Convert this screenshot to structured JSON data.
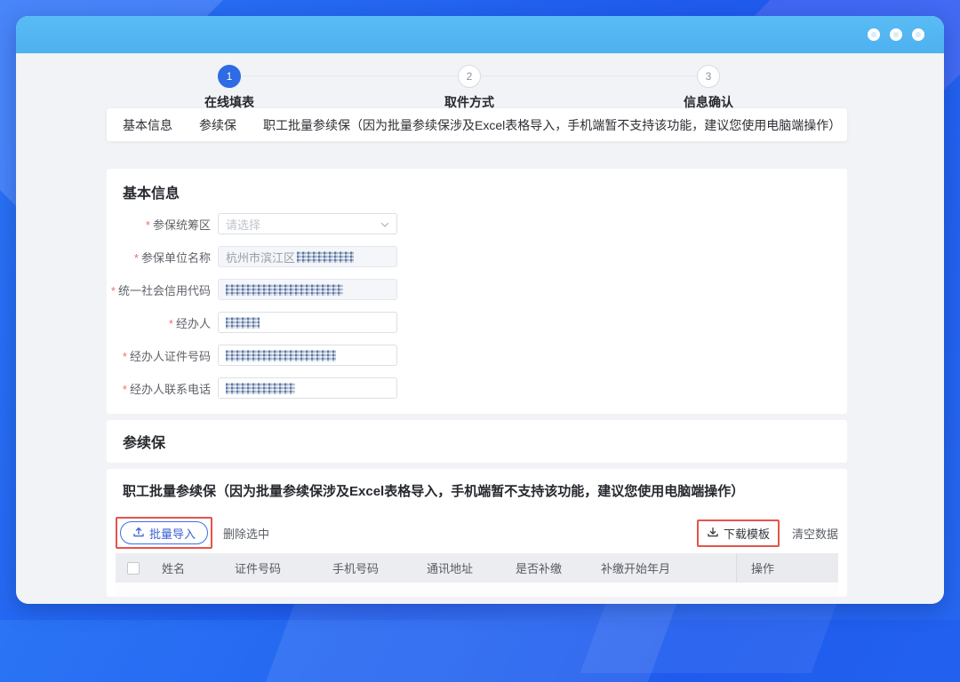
{
  "stepper": {
    "steps": [
      {
        "number": "1",
        "label": "在线填表"
      },
      {
        "number": "2",
        "label": "取件方式"
      },
      {
        "number": "3",
        "label": "信息确认"
      }
    ],
    "active_step": 1
  },
  "nav_tabs": {
    "items": [
      {
        "label": "基本信息"
      },
      {
        "label": "参续保"
      },
      {
        "label": "职工批量参续保（因为批量参续保涉及Excel表格导入，手机端暂不支持该功能，建议您使用电脑端操作）"
      }
    ]
  },
  "basic_info": {
    "title": "基本信息",
    "fields": [
      {
        "label": "参保统筹区",
        "required": "*",
        "type": "select",
        "placeholder": "请选择",
        "masked": false
      },
      {
        "label": "参保单位名称",
        "required": "*",
        "type": "text",
        "disabled": true,
        "value_visible": "杭州市滨江区",
        "masked": true
      },
      {
        "label": "统一社会信用代码",
        "required": "*",
        "type": "text",
        "disabled": true,
        "value_visible": "",
        "masked": true
      },
      {
        "label": "经办人",
        "required": "*",
        "type": "text",
        "disabled": false,
        "value_visible": "",
        "masked": true
      },
      {
        "label": "经办人证件号码",
        "required": "*",
        "type": "text",
        "disabled": false,
        "value_visible": "",
        "masked": true
      },
      {
        "label": "经办人联系电话",
        "required": "*",
        "type": "text",
        "disabled": false,
        "value_visible": "",
        "masked": true
      }
    ]
  },
  "renewal_section": {
    "title": "参续保"
  },
  "batch_section": {
    "title": "职工批量参续保（因为批量参续保涉及Excel表格导入，手机端暂不支持该功能，建议您使用电脑端操作）",
    "toolbar": {
      "import_button": "批量导入",
      "delete_selected": "删除选中",
      "download_template": "下载模板",
      "clear_data": "清空数据"
    },
    "table": {
      "columns": [
        "姓名",
        "证件号码",
        "手机号码",
        "通讯地址",
        "是否补缴",
        "补缴开始年月",
        "操作"
      ]
    }
  },
  "colors": {
    "frame_blue": "#2667f0",
    "titlebar_blue": "#54b7f2",
    "primary_blue": "#2e6be5",
    "annotation_red": "#e5534a",
    "required_red": "#f56c6c"
  }
}
